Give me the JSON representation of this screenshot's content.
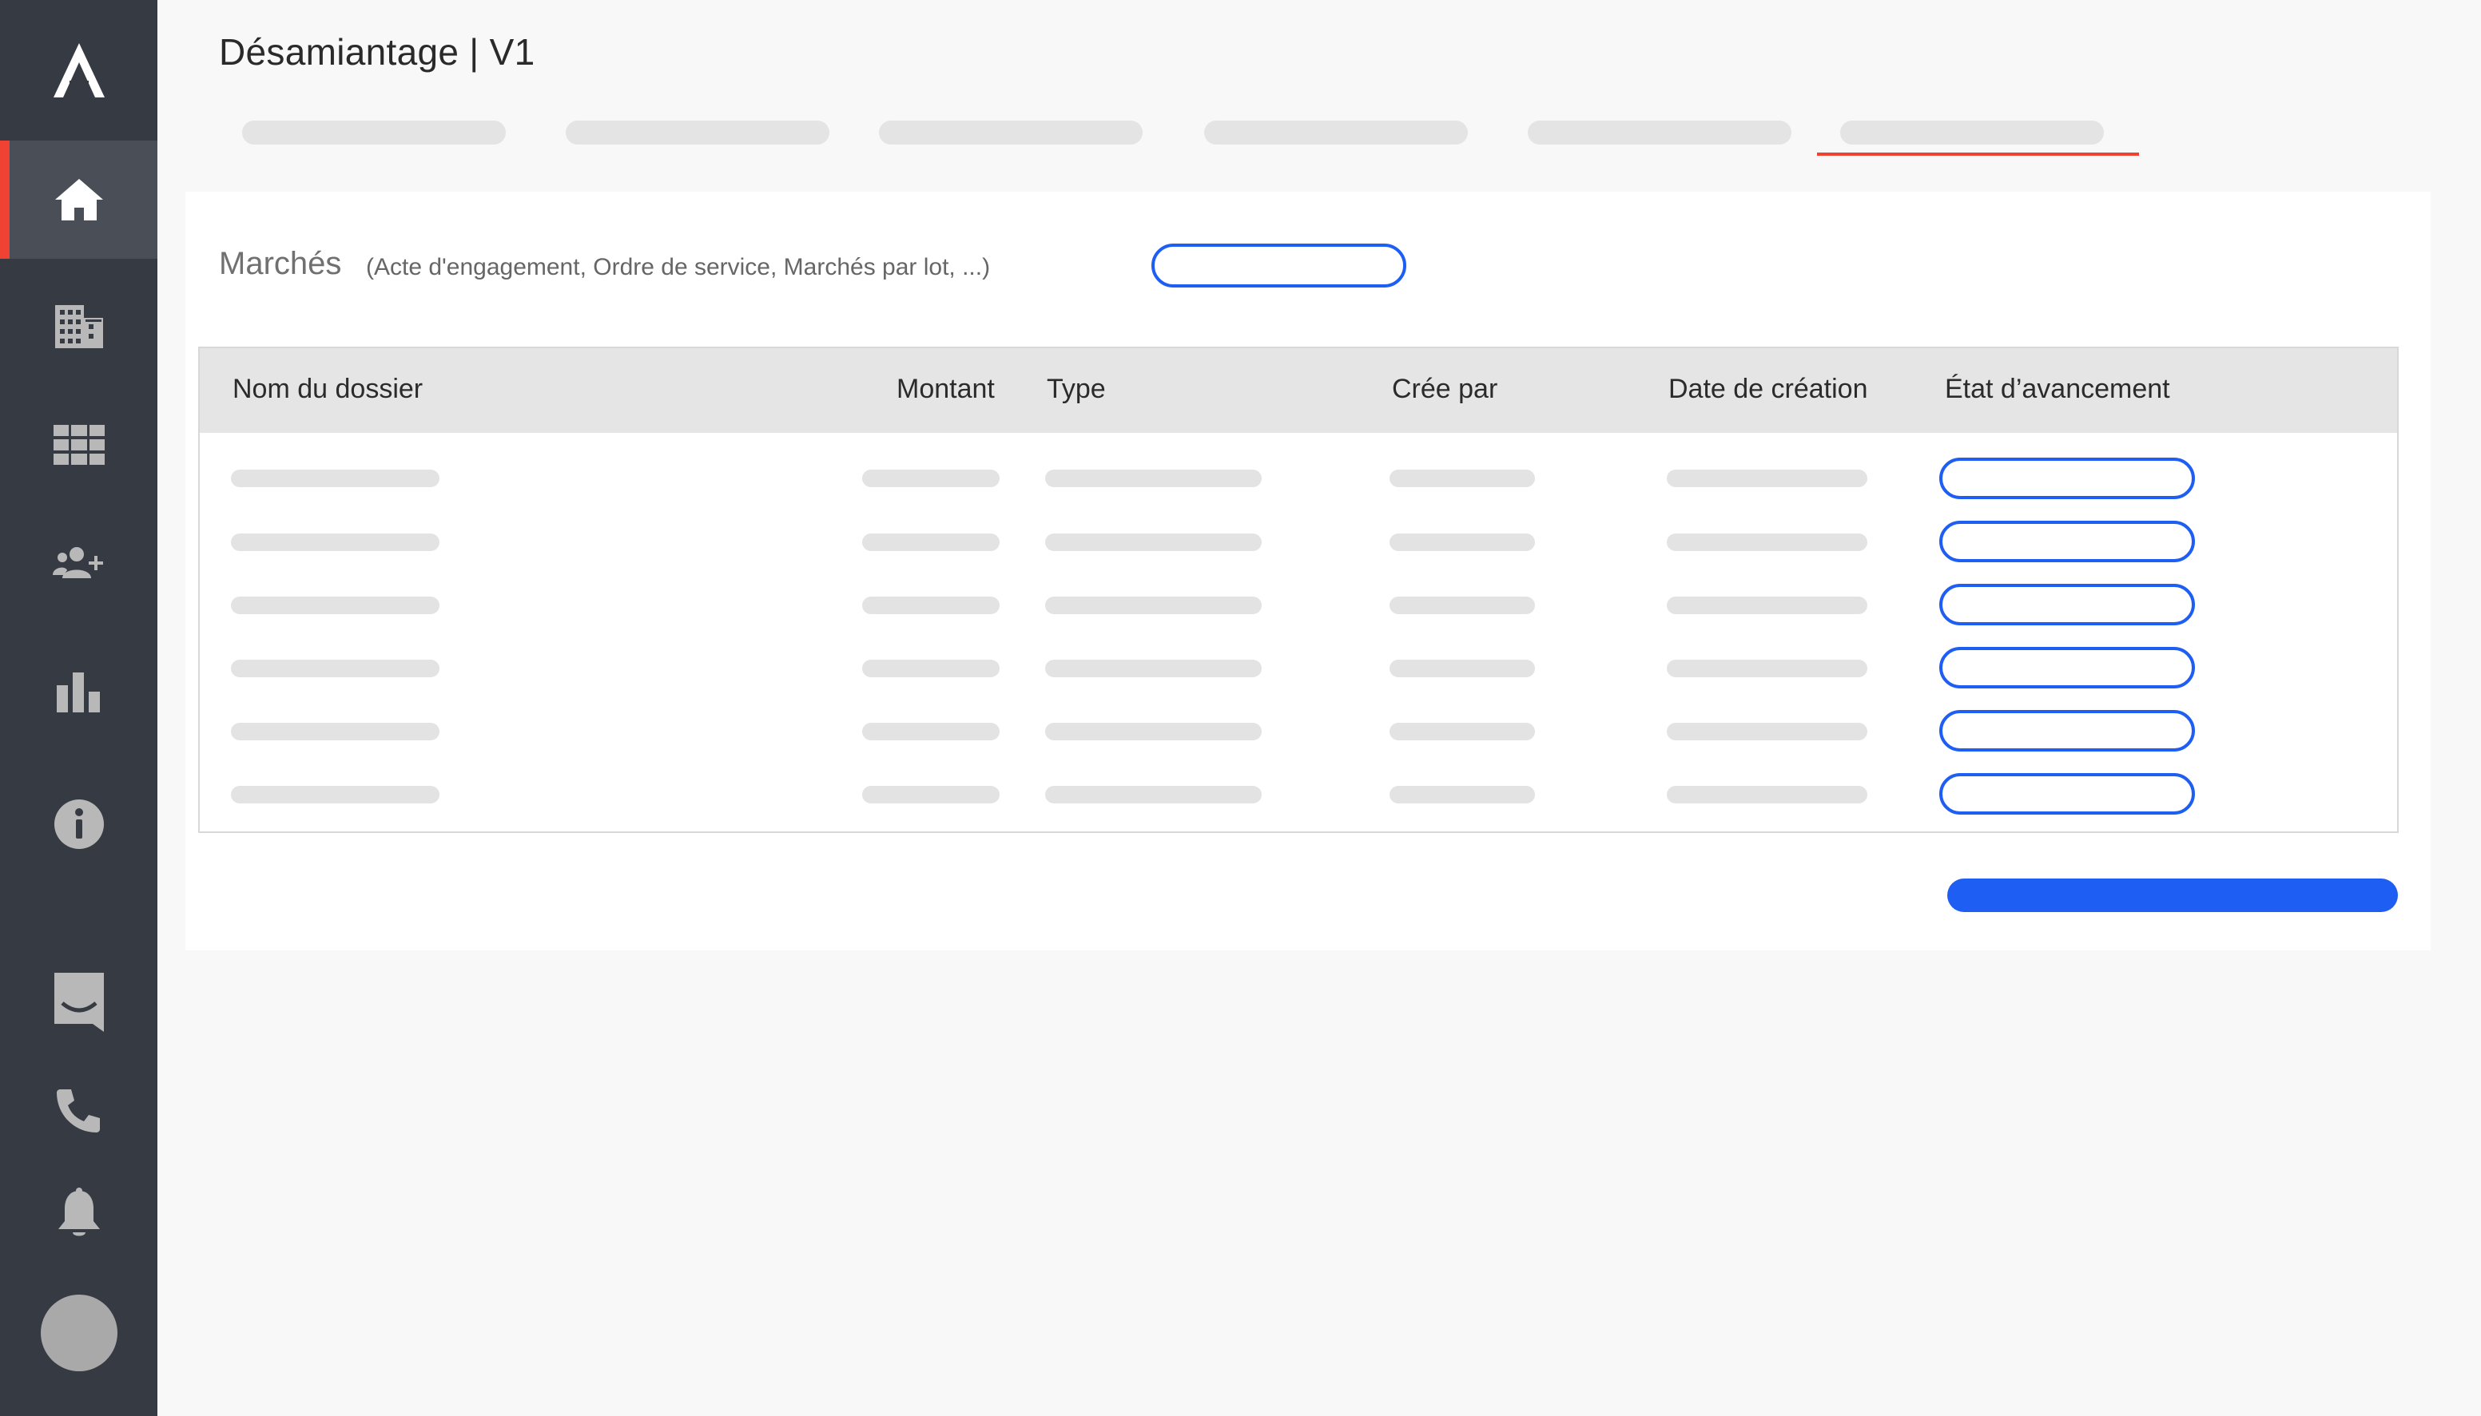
{
  "app": {
    "logo_icon": "a-logo-icon",
    "accent_color": "#ef4232",
    "primary_color": "#1f5ef2"
  },
  "sidebar": {
    "items": [
      {
        "icon": "home-icon",
        "active": true
      },
      {
        "icon": "building-icon",
        "active": false
      },
      {
        "icon": "grid-icon",
        "active": false
      },
      {
        "icon": "add-user-icon",
        "active": false
      },
      {
        "icon": "bar-chart-icon",
        "active": false
      },
      {
        "icon": "info-icon",
        "active": false
      },
      {
        "icon": "inbox-icon",
        "active": false
      },
      {
        "icon": "phone-icon",
        "active": false
      },
      {
        "icon": "bell-icon",
        "active": false
      }
    ]
  },
  "header": {
    "title": "Désamiantage | V1",
    "active_tab_index": 5
  },
  "section": {
    "title": "Marchés",
    "subtitle": "(Acte d'engagement, Ordre de service, Marchés par lot, ...)"
  },
  "table": {
    "columns": [
      "Nom du dossier",
      "Montant",
      "Type",
      "Crée par",
      "Date de création",
      "État d’avancement"
    ],
    "row_count": 6
  }
}
